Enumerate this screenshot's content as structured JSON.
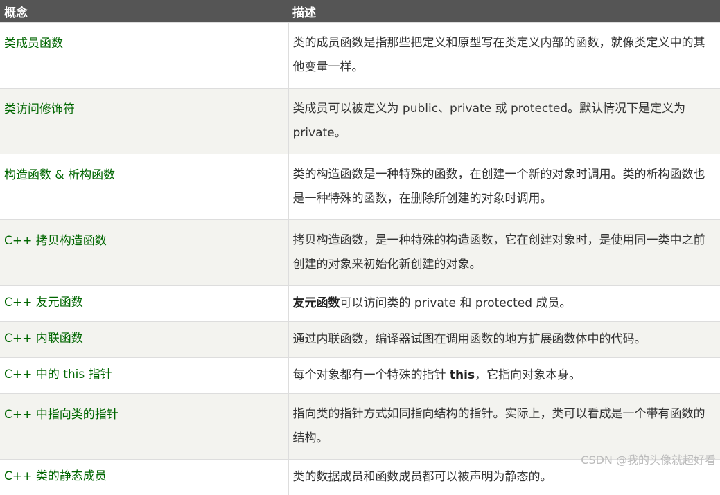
{
  "header": {
    "concept": "概念",
    "description": "描述"
  },
  "rows": [
    {
      "concept": "类成员函数",
      "desc": "类的成员函数是指那些把定义和原型写在类定义内部的函数，就像类定义中的其他变量一样。"
    },
    {
      "concept": "类访问修饰符",
      "desc": "类成员可以被定义为 public、private 或 protected。默认情况下是定义为 private。"
    },
    {
      "concept": "构造函数 & 析构函数",
      "desc": "类的构造函数是一种特殊的函数，在创建一个新的对象时调用。类的析构函数也是一种特殊的函数，在删除所创建的对象时调用。"
    },
    {
      "concept": "C++ 拷贝构造函数",
      "desc": "拷贝构造函数，是一种特殊的构造函数，它在创建对象时，是使用同一类中之前创建的对象来初始化新创建的对象。"
    },
    {
      "concept": "C++ 友元函数",
      "desc_bold": "友元函数",
      "desc_rest": "可以访问类的 private 和 protected 成员。"
    },
    {
      "concept": "C++ 内联函数",
      "desc": "通过内联函数，编译器试图在调用函数的地方扩展函数体中的代码。"
    },
    {
      "concept": "C++ 中的 this 指针",
      "desc_pre": "每个对象都有一个特殊的指针 ",
      "desc_bold": "this",
      "desc_post": "，它指向对象本身。"
    },
    {
      "concept": "C++ 中指向类的指针",
      "desc": "指向类的指针方式如同指向结构的指针。实际上，类可以看成是一个带有函数的结构。"
    },
    {
      "concept": "C++ 类的静态成员",
      "desc": "类的数据成员和函数成员都可以被声明为静态的。"
    }
  ],
  "watermark": "CSDN @我的头像就超好看",
  "colors": {
    "header_bg": "#555555",
    "link_green": "#006600",
    "alt_row": "#f3f3ef"
  }
}
